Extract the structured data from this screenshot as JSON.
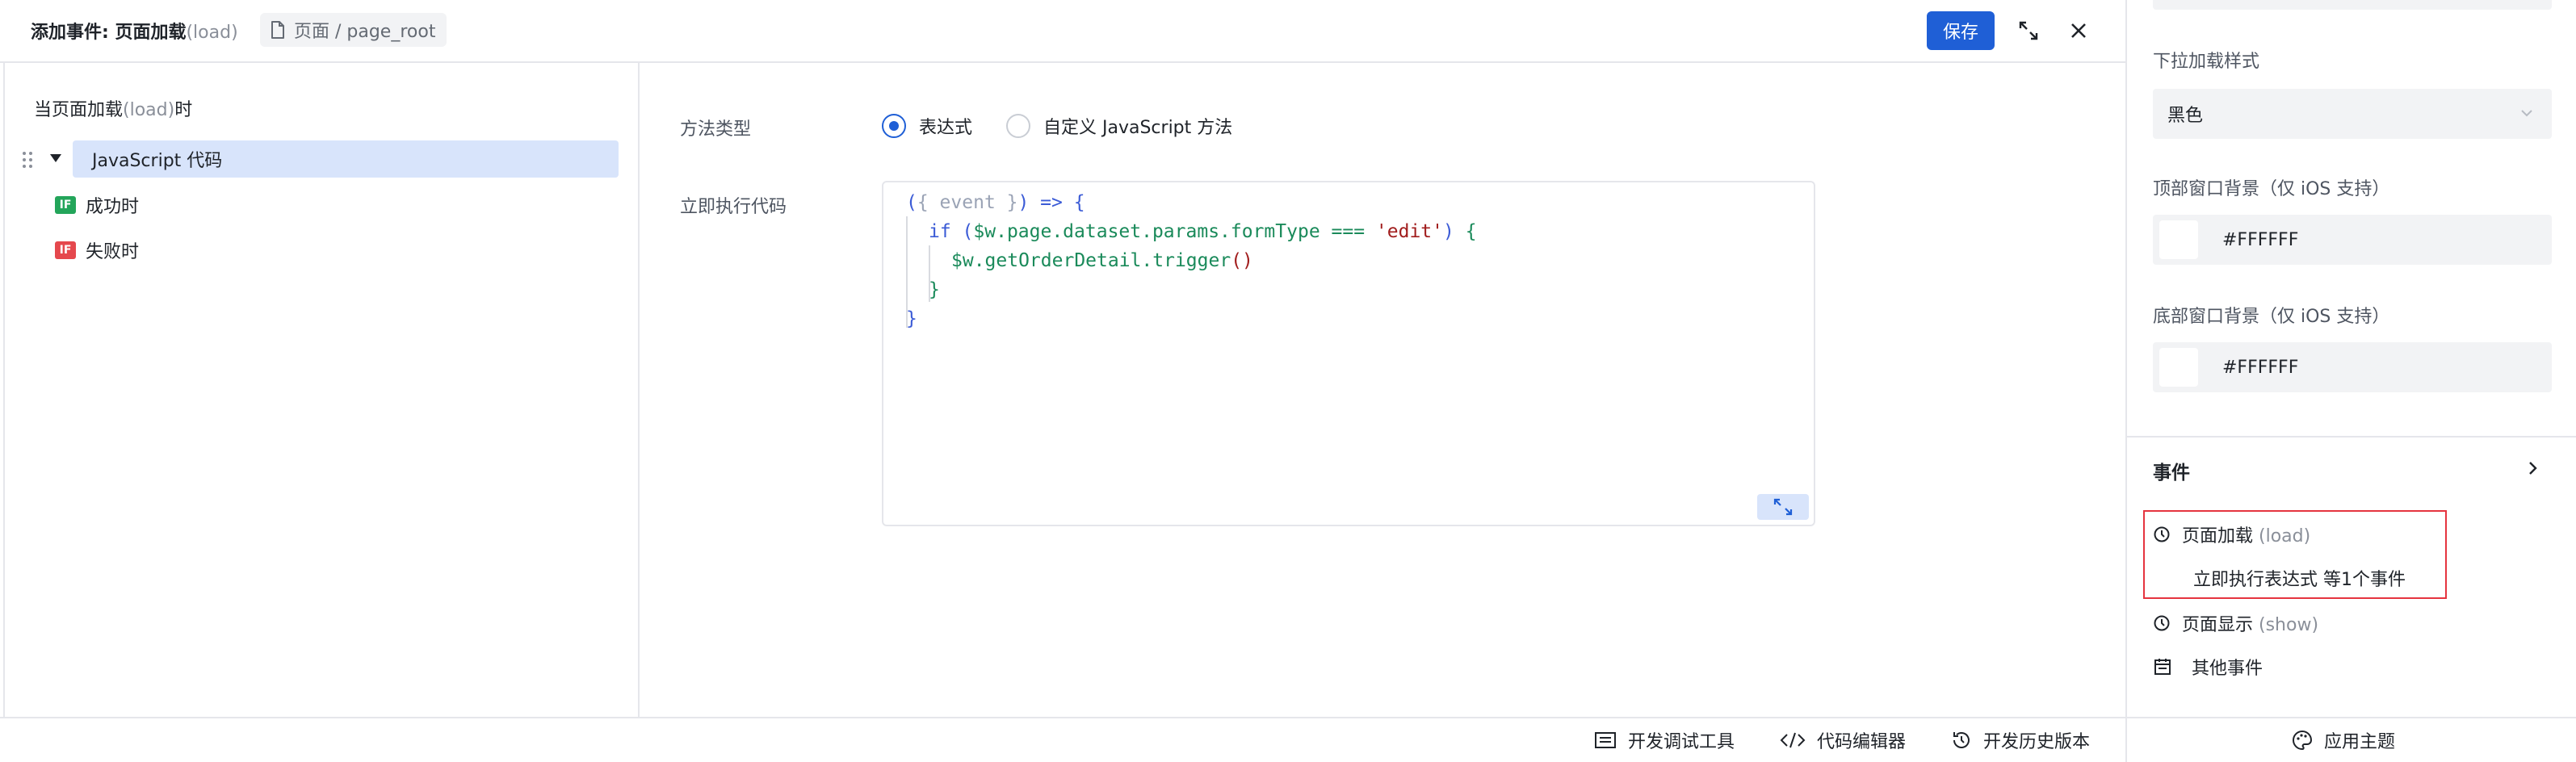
{
  "header": {
    "title_main": "添加事件: 页面加载",
    "title_suffix": "(load)",
    "breadcrumb": "页面 / page_root",
    "save_label": "保存"
  },
  "left": {
    "heading_main": "当页面加载",
    "heading_dim": "(load)",
    "heading_tail": "时",
    "action": "JavaScript 代码",
    "success": "成功时",
    "failure": "失败时",
    "if_tag": "IF",
    "success_color": "#23a55a",
    "failure_color": "#e5484d"
  },
  "main": {
    "method_label": "方法类型",
    "option_expression": "表达式",
    "option_custom": "自定义 JavaScript 方法",
    "code_label": "立即执行代码",
    "code_lines": [
      "({ event }) => {",
      "if ($w.page.dataset.params.formType === 'edit') {",
      "$w.getOrderDetail.trigger()",
      "}",
      "}"
    ]
  },
  "right": {
    "pull_style_label": "下拉加载样式",
    "pull_style_value": "黑色",
    "top_bg_label": "顶部窗口背景（仅 iOS 支持）",
    "top_bg_value": "#FFFFFF",
    "bottom_bg_label": "底部窗口背景（仅 iOS 支持）",
    "bottom_bg_value": "#FFFFFF",
    "events_title": "事件",
    "events": {
      "load_label": "页面加载",
      "load_dim": "(load)",
      "load_detail": "立即执行表达式 等1个事件",
      "show_label": "页面显示",
      "show_dim": "(show)",
      "other_label": "其他事件"
    }
  },
  "bottom": {
    "debug_tools": "开发调试工具",
    "code_editor": "代码编辑器",
    "history": "开发历史版本",
    "app_theme": "应用主题"
  },
  "colors": {
    "primary": "#1f5fd6",
    "selected_bg": "#d8e4fb",
    "highlight_border": "#e5343f"
  }
}
